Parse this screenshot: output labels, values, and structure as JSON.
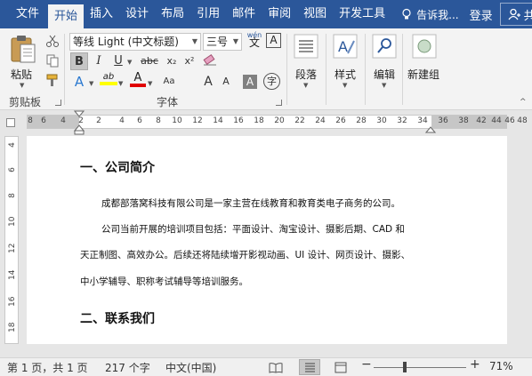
{
  "tabs": [
    "文件",
    "开始",
    "插入",
    "设计",
    "布局",
    "引用",
    "邮件",
    "审阅",
    "视图",
    "开发工具"
  ],
  "active_tab": "开始",
  "tell_me": "告诉我...",
  "login": "登录",
  "share": "共享",
  "clipboard": {
    "paste_label": "粘贴",
    "group_label": "剪贴板"
  },
  "font": {
    "name": "等线 Light (中文标题)",
    "size": "三号",
    "group_label": "字体",
    "wen": "wén",
    "wen_char": "文",
    "A_box": "A",
    "bold": "B",
    "italic": "I",
    "underline": "U",
    "strike": "abc",
    "sub": "x₂",
    "sup": "x²",
    "grow": "A",
    "shrink": "A",
    "aa": "Aa",
    "clear": "A",
    "effects": "A",
    "highlight": "ab",
    "color": "A",
    "shade": "A",
    "circle": "字"
  },
  "paragraph": {
    "label": "段落"
  },
  "styles": {
    "label": "样式"
  },
  "editing": {
    "label": "编辑"
  },
  "new_group": {
    "label": "新建组"
  },
  "ruler_numbers": [
    "8",
    "6",
    "4",
    "2",
    "2",
    "4",
    "6",
    "8",
    "10",
    "12",
    "14",
    "16",
    "18",
    "20",
    "22",
    "24",
    "26",
    "28",
    "30",
    "32",
    "34",
    "36",
    "38",
    "42",
    "44",
    "46",
    "48"
  ],
  "vruler_numbers": [
    "4",
    "6",
    "8",
    "10",
    "12",
    "14",
    "16",
    "18"
  ],
  "document": {
    "heading1": "一、公司简介",
    "p1": "成都部落窝科技有限公司是一家主营在线教育和教育类电子商务的公司。",
    "p2_line1": "公司当前开展的培训项目包括：平面设计、淘宝设计、摄影后期、CAD 和",
    "p2_line2": "天正制图、高效办公。后续还将陆续增开影视动画、UI 设计、网页设计、摄影、",
    "p2_line3": "中小学辅导、职称考试辅导等培训服务。",
    "heading2": "二、联系我们"
  },
  "status": {
    "page": "第 1 页，共 1 页",
    "words": "217 个字",
    "lang": "中文(中国)",
    "zoom": "71%"
  },
  "colors": {
    "accent": "#2b579a",
    "highlight": "#ffff00",
    "font_color": "#e00000"
  }
}
